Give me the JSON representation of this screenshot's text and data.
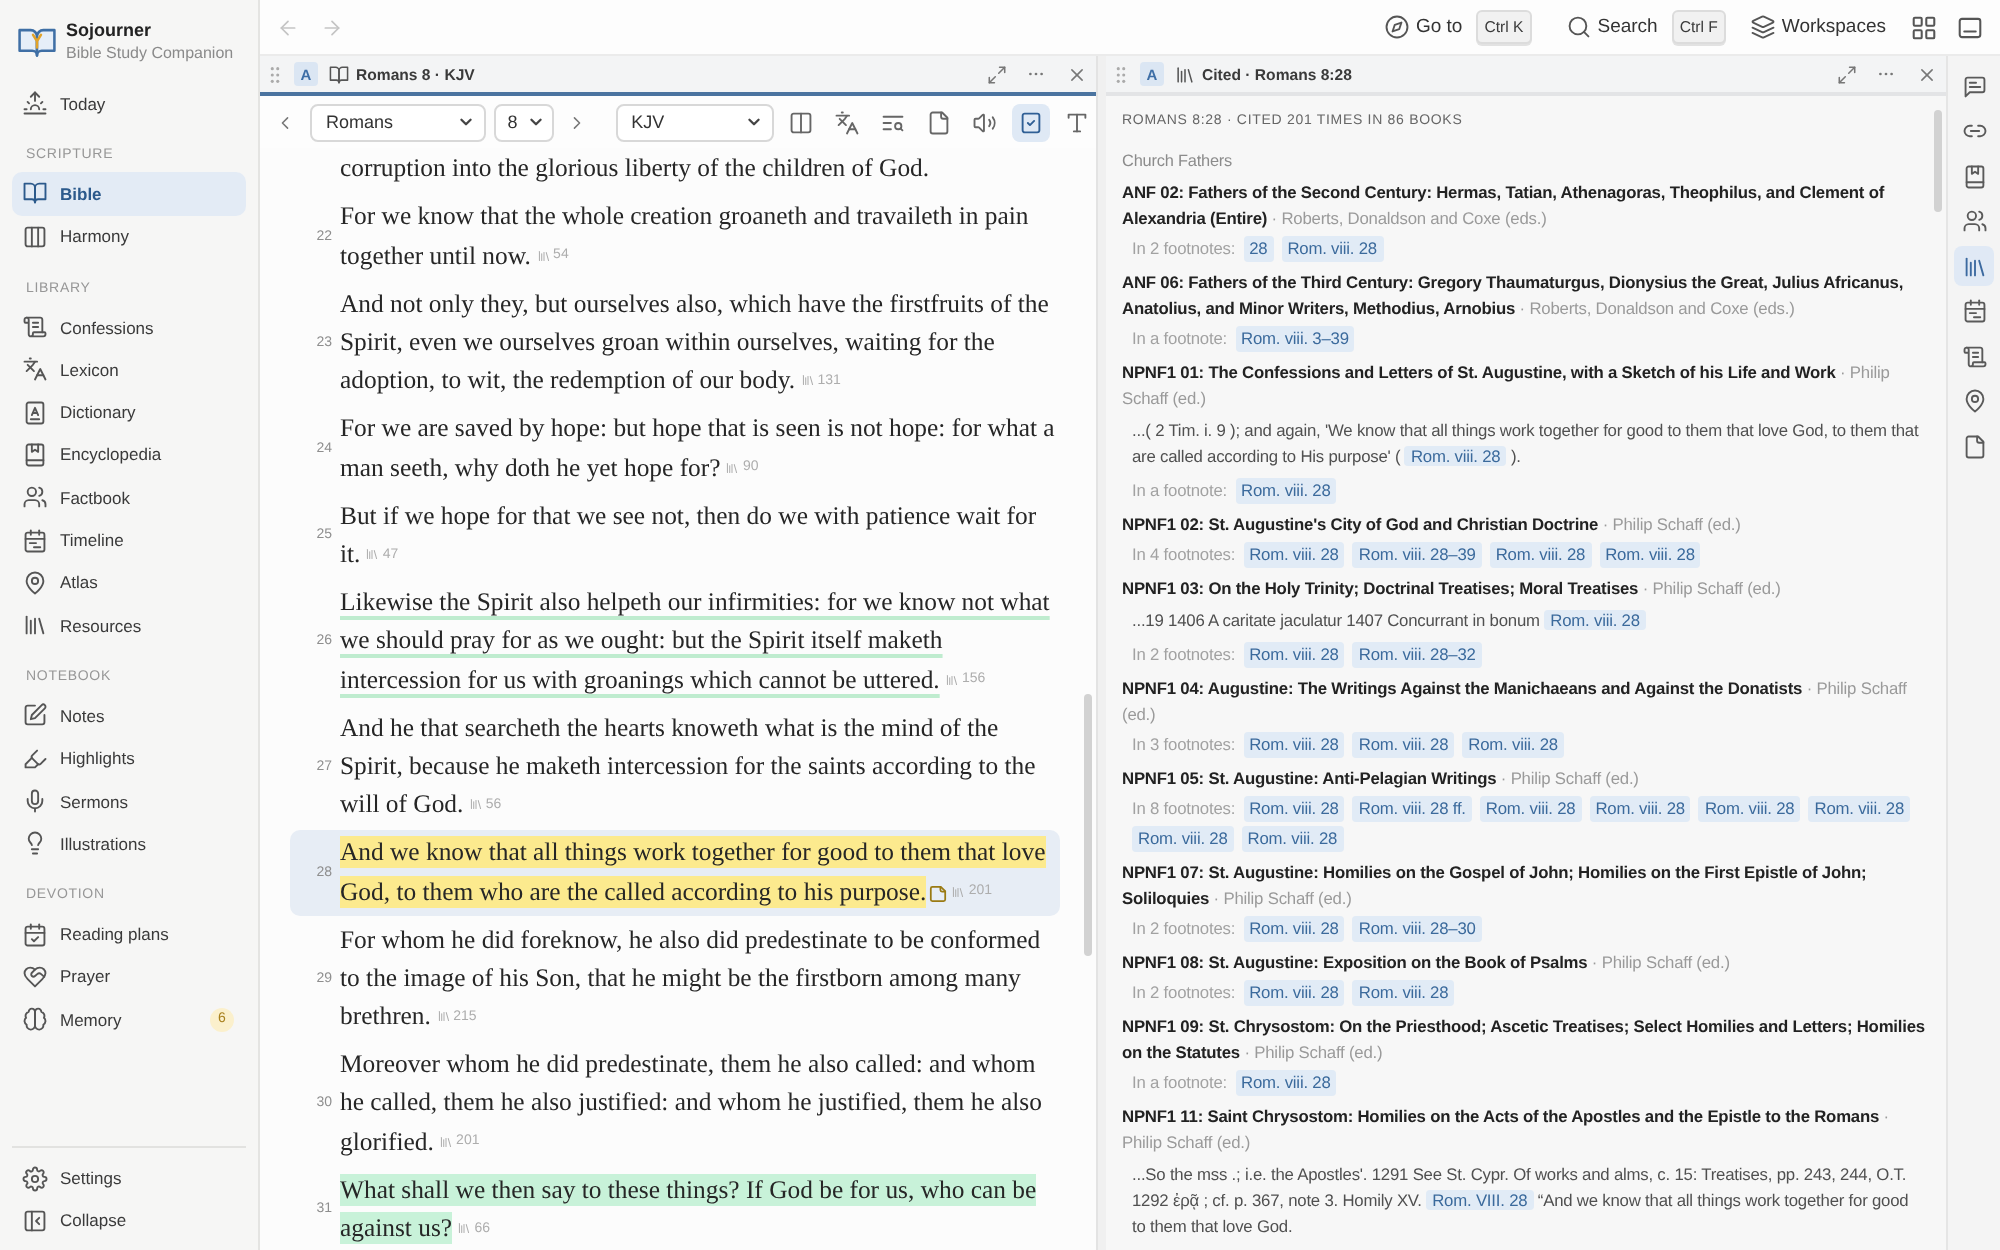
{
  "app": {
    "name": "Sojourner",
    "tagline": "Bible Study Companion"
  },
  "sidebar": {
    "top_items": [
      {
        "label": "Today",
        "selected": false
      }
    ],
    "sections": [
      {
        "title": "SCRIPTURE",
        "items": [
          {
            "label": "Bible",
            "selected": true
          },
          {
            "label": "Harmony",
            "selected": false
          }
        ]
      },
      {
        "title": "LIBRARY",
        "items": [
          {
            "label": "Confessions",
            "selected": false
          },
          {
            "label": "Lexicon",
            "selected": false
          },
          {
            "label": "Dictionary",
            "selected": false
          },
          {
            "label": "Encyclopedia",
            "selected": false
          },
          {
            "label": "Factbook",
            "selected": false
          },
          {
            "label": "Timeline",
            "selected": false
          },
          {
            "label": "Atlas",
            "selected": false
          },
          {
            "label": "Resources",
            "selected": false
          }
        ]
      },
      {
        "title": "NOTEBOOK",
        "items": [
          {
            "label": "Notes",
            "selected": false
          },
          {
            "label": "Highlights",
            "selected": false
          },
          {
            "label": "Sermons",
            "selected": false
          },
          {
            "label": "Illustrations",
            "selected": false
          }
        ]
      },
      {
        "title": "DEVOTION",
        "items": [
          {
            "label": "Reading plans",
            "selected": false
          },
          {
            "label": "Prayer",
            "selected": false
          },
          {
            "label": "Memory",
            "selected": false,
            "badge": "6"
          }
        ]
      }
    ],
    "footer_items": [
      {
        "label": "Settings",
        "selected": false
      },
      {
        "label": "Collapse",
        "selected": false
      }
    ]
  },
  "top_bar": {
    "back": {
      "disabled": true
    },
    "forward": {
      "disabled": true
    },
    "actions": [
      {
        "label": "Go to",
        "shortcut": "Ctrl K"
      },
      {
        "label": "Search",
        "shortcut": "Ctrl F"
      },
      {
        "label": "Workspaces"
      }
    ]
  },
  "reader_pane": {
    "active": true,
    "badge": "A",
    "title": "Romans 8 · KJV",
    "book": "Romans",
    "chapter": "8",
    "version": "KJV",
    "tools": [
      {
        "selected": false
      },
      {
        "selected": false
      },
      {
        "selected": false
      },
      {
        "selected": false
      },
      {
        "selected": false
      },
      {
        "selected": true
      },
      {
        "selected": false
      }
    ],
    "verse_fragment": "corruption into the glorious liberty of the children of God.",
    "verses": [
      {
        "number": "22",
        "text": "For we know that the whole creation groaneth and travaileth in pain together until now.",
        "citations": "54",
        "selected": false,
        "note": false
      },
      {
        "number": "23",
        "text": "And not only they, but ourselves also, which have the firstfruits of the Spirit, even we ourselves groan within ourselves, waiting for the adoption, to wit, the redemption of our body.",
        "citations": "131",
        "selected": false,
        "note": false
      },
      {
        "number": "24",
        "text": "For we are saved by hope: but hope that is seen is not hope: for what a man seeth, why doth he yet hope for?",
        "citations": "90",
        "selected": false,
        "note": false
      },
      {
        "number": "25",
        "text": "But if we hope for that we see not, then do we with patience wait for it.",
        "citations": "47",
        "selected": false,
        "note": false
      },
      {
        "number": "26",
        "text": "Likewise the Spirit also helpeth our infirmities: for we know not what we should pray for as we ought: but the Spirit itself maketh intercession for us with groanings which cannot be uttered.",
        "citations": "156",
        "selected": false,
        "note": false,
        "highlight": {
          "kind": "underline",
          "color": "#bfeccf"
        }
      },
      {
        "number": "27",
        "text": "And he that searcheth the hearts knoweth what is the mind of the Spirit, because he maketh intercession for the saints according to the will of God.",
        "citations": "56",
        "selected": false,
        "note": false
      },
      {
        "number": "28",
        "text": "And we know that all things work together for good to them that love God, to them who are the called according to his purpose.",
        "citations": "201",
        "selected": true,
        "note": true,
        "highlight": {
          "kind": "fill",
          "color": "#fcea8e"
        }
      },
      {
        "number": "29",
        "text": "For whom he did foreknow, he also did predestinate to be conformed to the image of his Son, that he might be the firstborn among many brethren.",
        "citations": "215",
        "selected": false,
        "note": false
      },
      {
        "number": "30",
        "text": "Moreover whom he did predestinate, them he also called: and whom he called, them he also justified: and whom he justified, them he also glorified.",
        "citations": "201",
        "selected": false,
        "note": false
      },
      {
        "number": "31",
        "text": "What shall we then say to these things? If God be for us, who can be against us?",
        "citations": "66",
        "selected": false,
        "note": false,
        "highlight": {
          "kind": "fill",
          "color": "#c8f2d9"
        }
      }
    ]
  },
  "cited_pane": {
    "active": false,
    "badge": "A",
    "title": "Cited · Romans 8:28",
    "heading": "ROMANS 8:28 · CITED 201 TIMES IN 86 BOOKS",
    "group": "Church Fathers",
    "entries": [
      {
        "title": "**ANF 02: Fathers of the Second Century: Hermas, Tatian, Athenagoras, Theophilus, and Clement of Alexandria (Entire)** · Roberts, Donaldson and Coxe (eds.)",
        "footnotes_label": "In 2 footnotes:",
        "refs": [
          "28",
          "Rom. viii. 28"
        ]
      },
      {
        "title": "**ANF 06: Fathers of the Third Century: Gregory Thaumaturgus, Dionysius the Great, Julius Africanus, Anatolius, and Minor Writers, Methodius, Arnobius** · Roberts, Donaldson and Coxe (eds.)",
        "footnotes_label": "In a footnote:",
        "refs": [
          "Rom. viii. 3–39"
        ]
      },
      {
        "title": "**NPNF1 01: The Confessions and Letters of St. Augustine, with a Sketch of his Life and Work** · Philip Schaff (ed.)",
        "excerpt": {
          "before": "...( 2 Tim. i. 9 ); and again, 'We know that all things work together for good to them that love God, to them that are called according to His purpose' ( ",
          "ref": "Rom. viii. 28",
          "after": " )."
        },
        "footnotes_label": "In a footnote:",
        "refs": [
          "Rom. viii. 28"
        ]
      },
      {
        "title": "**NPNF1 02: St. Augustine's City of God and Christian Doctrine** · Philip Schaff (ed.)",
        "footnotes_label": "In 4 footnotes:",
        "refs": [
          "Rom. viii. 28",
          "Rom. viii. 28–39",
          "Rom. viii. 28",
          "Rom. viii. 28"
        ]
      },
      {
        "title": "**NPNF1 03: On the Holy Trinity; Doctrinal Treatises; Moral Treatises** · Philip Schaff (ed.)",
        "excerpt": {
          "before": "...19 1406 A caritate jaculatur 1407 Concurrant in bonum ",
          "ref": "Rom. viii. 28"
        },
        "footnotes_label": "In 2 footnotes:",
        "refs": [
          "Rom. viii. 28",
          "Rom. viii. 28–32"
        ]
      },
      {
        "title": "**NPNF1 04: Augustine: The Writings Against the Manichaeans and Against the Donatists** · Philip Schaff (ed.)",
        "footnotes_label": "In 3 footnotes:",
        "refs": [
          "Rom. viii. 28",
          "Rom. viii. 28",
          "Rom. viii. 28"
        ]
      },
      {
        "title": "**NPNF1 05: St. Augustine: Anti-Pelagian Writings** · Philip Schaff (ed.)",
        "footnotes_label": "In 8 footnotes:",
        "refs": [
          "Rom. viii. 28",
          "Rom. viii. 28 ff.",
          "Rom. viii. 28",
          "Rom. viii. 28",
          "Rom. viii. 28",
          "Rom. viii. 28",
          "Rom. viii. 28",
          "Rom. viii. 28"
        ]
      },
      {
        "title": "**NPNF1 07: St. Augustine: Homilies on the Gospel of John; Homilies on the First Epistle of John; Soliloquies** · Philip Schaff (ed.)",
        "footnotes_label": "In 2 footnotes:",
        "refs": [
          "Rom. viii. 28",
          "Rom. viii. 28–30"
        ]
      },
      {
        "title": "**NPNF1 08: St. Augustine: Exposition on the Book of Psalms** · Philip Schaff (ed.)",
        "footnotes_label": "In 2 footnotes:",
        "refs": [
          "Rom. viii. 28",
          "Rom. viii. 28"
        ]
      },
      {
        "title": "**NPNF1 09: St. Chrysostom: On the Priesthood; Ascetic Treatises; Select Homilies and Letters; Homilies on the Statutes** · Philip Schaff (ed.)",
        "footnotes_label": "In a footnote:",
        "refs": [
          "Rom. viii. 28"
        ]
      },
      {
        "title": "**NPNF1 11: Saint Chrysostom: Homilies on the Acts of the Apostles and the Epistle to the Romans** · Philip Schaff (ed.)",
        "excerpt": {
          "before": "...So the mss .; i.e. the Apostles'. 1291 See St. Cypr. Of works and alms, c. 15: Treatises, pp. 243, 244, O.T. 1292 ἐρᾷ ; cf. p. 367, note 3. Homily XV. ",
          "ref": "Rom. VIII. 28",
          "after": " “And we know that all things work together for good to them that love God."
        }
      }
    ]
  },
  "right_rail": [
    {
      "selected": false
    },
    {
      "selected": false
    },
    {
      "selected": false
    },
    {
      "selected": false
    },
    {
      "selected": true
    },
    {
      "selected": false
    },
    {
      "selected": false
    },
    {
      "selected": false
    },
    {
      "selected": false
    }
  ]
}
